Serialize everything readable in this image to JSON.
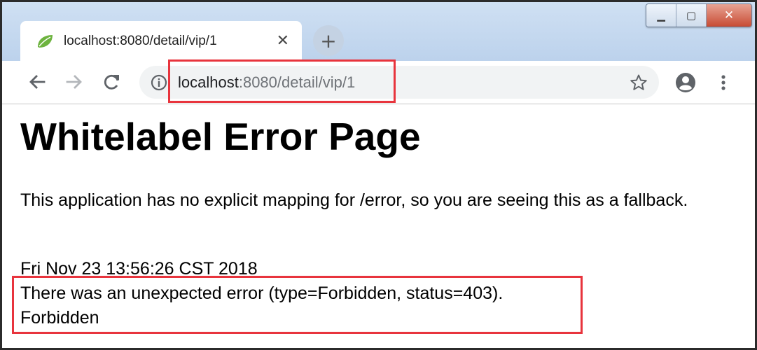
{
  "window": {
    "minimize_glyph": "▁",
    "maximize_glyph": "▢",
    "close_glyph": "✕"
  },
  "tab": {
    "title": "localhost:8080/detail/vip/1",
    "favicon": "spring-leaf-icon",
    "close_glyph": "✕"
  },
  "new_tab_glyph": "+",
  "address_bar": {
    "host": "localhost",
    "path": ":8080/detail/vip/1"
  },
  "page": {
    "heading": "Whitelabel Error Page",
    "explanation": "This application has no explicit mapping for /error, so you are seeing this as a fallback.",
    "timestamp": "Fri Nov 23 13:56:26 CST 2018",
    "error_line": "There was an unexpected error (type=Forbidden, status=403).",
    "error_message": "Forbidden"
  },
  "colors": {
    "highlight": "#e8343d",
    "favicon": "#6db33f"
  }
}
